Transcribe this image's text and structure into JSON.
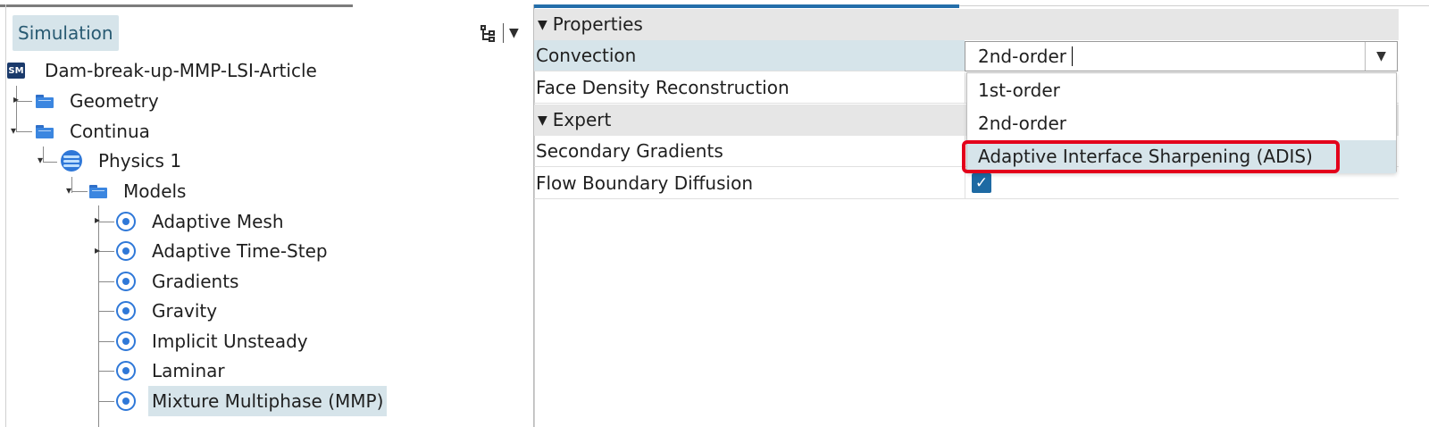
{
  "window": {
    "accent_color": "#246eaa",
    "selection_color": "#d6e4ea",
    "annotation_color": "#e3001b"
  },
  "tree_panel": {
    "tab_label": "Simulation",
    "tools": [
      {
        "name": "tree-structure-icon"
      },
      {
        "name": "chevron-down-icon"
      }
    ],
    "root": {
      "label": "Dam-break-up-MMP-LSI-Article",
      "icon_text": "SM"
    },
    "items": [
      {
        "label": "Geometry",
        "icon": "folder-icon"
      },
      {
        "label": "Continua",
        "icon": "folder-icon"
      },
      {
        "label": "Physics 1",
        "icon": "physics-icon"
      },
      {
        "label": "Models",
        "icon": "folder-icon"
      },
      {
        "label": "Adaptive Mesh",
        "icon": "model-icon"
      },
      {
        "label": "Adaptive Time-Step",
        "icon": "model-icon"
      },
      {
        "label": "Gradients",
        "icon": "model-icon"
      },
      {
        "label": "Gravity",
        "icon": "model-icon"
      },
      {
        "label": "Implicit Unsteady",
        "icon": "model-icon"
      },
      {
        "label": "Laminar",
        "icon": "model-icon"
      },
      {
        "label": "Mixture Multiphase (MMP)",
        "icon": "model-icon",
        "selected": true
      }
    ]
  },
  "properties_panel": {
    "sections": [
      {
        "title": "Properties",
        "rows": [
          {
            "name": "Convection",
            "value": "2nd-order"
          },
          {
            "name": "Face Density Reconstruction",
            "value": ""
          }
        ]
      },
      {
        "title": "Expert",
        "rows": [
          {
            "name": "Secondary Gradients",
            "value": ""
          },
          {
            "name": "Flow Boundary Diffusion",
            "value": "checked"
          }
        ]
      }
    ],
    "dropdown": {
      "selected": "2nd-order",
      "options": [
        "1st-order",
        "2nd-order",
        "Adaptive Interface Sharpening (ADIS)"
      ],
      "hovered_option": "Adaptive Interface Sharpening (ADIS)"
    }
  }
}
